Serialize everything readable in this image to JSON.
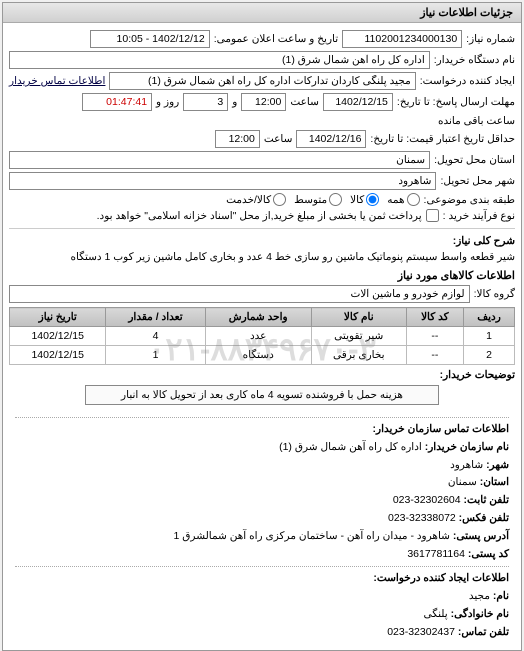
{
  "panel_title": "جزئیات اطلاعات نیاز",
  "fields": {
    "req_no_label": "شماره نیاز:",
    "req_no": "1102001234000130",
    "announce_label": "تاریخ و ساعت اعلان عمومی:",
    "announce_value": "1402/12/12 - 10:05",
    "org_label": "نام دستگاه خریدار:",
    "org_value": "اداره کل راه آهن شمال شرق (1)",
    "creator_label": "ایجاد کننده درخواست:",
    "creator_value": "مجید پلنگی کاردان تدارکات اداره کل راه آهن شمال شرق (1)",
    "contact_link": "اطلاعات تماس خریدار",
    "reply_deadline_label": "مهلت ارسال پاسخ: تا تاریخ:",
    "reply_date": "1402/12/15",
    "time_label": "ساعت",
    "reply_time": "12:00",
    "days_and": "و",
    "days_value": "3",
    "days_label": "روز و",
    "countdown": "01:47:41",
    "countdown_suffix": "ساعت باقی مانده",
    "validity_label": "حداقل تاریخ اعتبار قیمت: تا تاریخ:",
    "validity_date": "1402/12/16",
    "validity_time": "12:00",
    "province_label": "استان محل تحویل:",
    "province_value": "سمنان",
    "city_label": "شهر محل تحویل:",
    "city_value": "شاهرود",
    "class_label": "طبقه بندی موضوعی:",
    "radio_all": "همه",
    "radio_goods": "کالا",
    "radio_medium": "متوسط",
    "radio_service": "کالا/خدمت",
    "process_label": "نوع فرآیند خرید :",
    "process_note": "پرداخت ثمن یا بخشی از مبلغ خرید,از محل \"اسناد خزانه اسلامی\" خواهد بود.",
    "subject_label": "شرح کلی نیاز:",
    "subject_value": "شیر قطعه واسط سیستم پنوماتیک ماشین رو سازی خط 4 عدد و بخاری کامل ماشین زیر کوب 1 دستگاه",
    "goods_section": "اطلاعات کالاهای مورد نیاز",
    "group_label": "گروه کالا:",
    "group_value": "لوازم خودرو و ماشین آلات",
    "buyer_notes_label": "توضیحات خریدار:",
    "buyer_notes_value": "هزینه حمل با فروشنده تسویه 4 ماه کاری بعد از تحویل کالا به انبار"
  },
  "table": {
    "headers": {
      "row": "ردیف",
      "code": "کد کالا",
      "name": "نام کالا",
      "unit": "واحد شمارش",
      "qty": "تعداد / مقدار",
      "date": "تاریخ نیاز"
    },
    "rows": [
      {
        "row": "1",
        "code": "--",
        "name": "شیر تقویتی",
        "unit": "عدد",
        "qty": "4",
        "date": "1402/12/15"
      },
      {
        "row": "2",
        "code": "--",
        "name": "بخاری برقی",
        "unit": "دستگاه",
        "qty": "1",
        "date": "1402/12/15"
      }
    ]
  },
  "contact": {
    "buyer_header": "اطلاعات تماس سازمان خریدار:",
    "org_name_k": "نام سازمان خریدار:",
    "org_name_v": "اداره کل راه آهن شمال شرق (1)",
    "city_k": "شهر:",
    "city_v": "شاهرود",
    "province_k": "استان:",
    "province_v": "سمنان",
    "phone_k": "تلفن ثابت:",
    "phone_v": "32302604-023",
    "fax_k": "تلفن فکس:",
    "fax_v": "32338072-023",
    "postal_k": "آدرس پستی:",
    "postal_v": "شاهرود - میدان راه آهن - ساختمان مرکزی راه آهن شمالشرق 1",
    "zip_k": "کد پستی:",
    "zip_v": "3617781164",
    "creator_header": "اطلاعات ایجاد کننده درخواست:",
    "name_k": "نام:",
    "name_v": "مجید",
    "lname_k": "نام خانوادگی:",
    "lname_v": "پلنگی",
    "cphone_k": "تلفن تماس:",
    "cphone_v": "32302437-023"
  },
  "watermark": "۰۲۱-۸۸۳۴۹۶۷۰-۳"
}
